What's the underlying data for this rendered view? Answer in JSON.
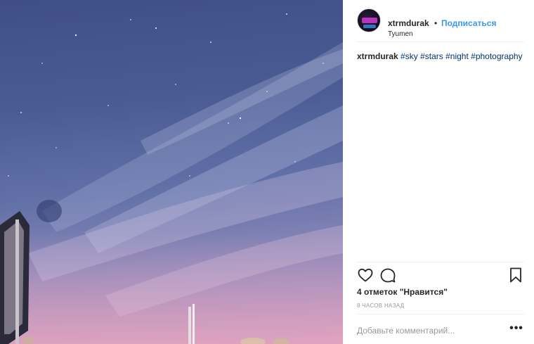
{
  "post": {
    "username": "xtrmdurak",
    "separator": "•",
    "follow_label": "Подписаться",
    "location": "Tyumen",
    "caption_user": "xtrmdurak",
    "hashtags": [
      "#sky",
      "#stars",
      "#night",
      "#photography"
    ],
    "likes_text": "4 отметок \"Нравится\"",
    "time_text": "8 ЧАСОВ НАЗАД",
    "comment_placeholder": "Добавьте комментарий...",
    "more_label": "•••"
  },
  "icons": {
    "like": "heart-icon",
    "comment": "comment-bubble-icon",
    "save": "bookmark-icon",
    "more": "more-options-icon"
  },
  "colors": {
    "link_blue": "#3897f0",
    "hashtag": "#003569",
    "muted": "#999999"
  }
}
